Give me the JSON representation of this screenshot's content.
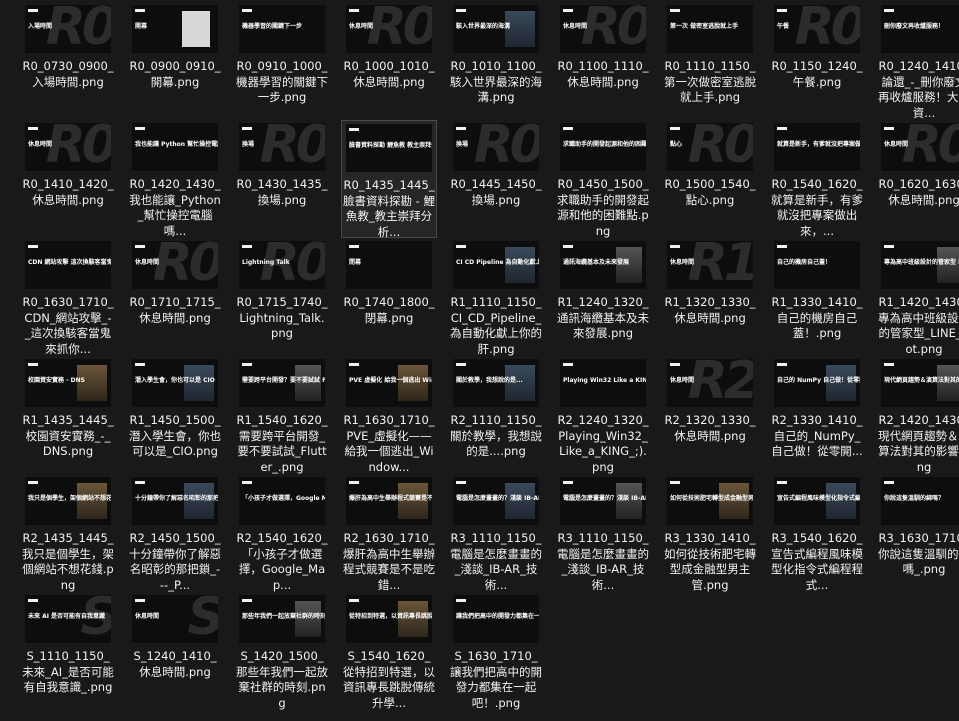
{
  "items": [
    {
      "id": "r0-0730",
      "label": "R0_0730_0900_入場時間.png",
      "thumb": "入場時間",
      "bg": "R0"
    },
    {
      "id": "r0-0900",
      "label": "R0_0900_0910_開幕.png",
      "thumb": "開幕",
      "bg": ""
    },
    {
      "id": "r0-0910",
      "label": "R0_0910_1000_機器學習的關鍵下一步.png",
      "thumb": "機器學習的關鍵下一步",
      "bg": ""
    },
    {
      "id": "r0-1000",
      "label": "R0_1000_1010_休息時間.png",
      "thumb": "休息時間",
      "bg": "R0"
    },
    {
      "id": "r0-1010",
      "label": "R0_1010_1100_駭入世界最深的海溝.png",
      "thumb": "駭入世界最深的海溝",
      "bg": ""
    },
    {
      "id": "r0-1100",
      "label": "R0_1100_1110_休息時間.png",
      "thumb": "休息時間",
      "bg": "R0"
    },
    {
      "id": "r0-1110",
      "label": "R0_1110_1150_第一次做密室逃脫就上手.png",
      "thumb": "第一次 做密室逃脫就上手",
      "bg": ""
    },
    {
      "id": "r0-1150",
      "label": "R0_1150_1240_午餐.png",
      "thumb": "午餐",
      "bg": "R0"
    },
    {
      "id": "r0-1240",
      "label": "R0_1240_1410_論還_-_刪你廢文再收爐服務！大型資...",
      "thumb": "刪你廢文再收爐服務！",
      "bg": ""
    },
    {
      "id": "r0-1410",
      "label": "R0_1410_1420_休息時間.png",
      "thumb": "休息時間",
      "bg": "R0"
    },
    {
      "id": "r0-1420",
      "label": "R0_1420_1430_我也能讓_Python_幫忙操控電腦嗎...",
      "thumb": "我也能讓 Python 幫忙操控電腦嗎",
      "bg": ""
    },
    {
      "id": "r0-1430",
      "label": "R0_1430_1435_換場.png",
      "thumb": "換場",
      "bg": "R0"
    },
    {
      "id": "r0-1435",
      "label": "R0_1435_1445_臉書資料探勘 - 鯉魚教_教主崇拜分析...",
      "thumb": "臉書資料探勘 鯉魚教 教主崇拜分析",
      "bg": ""
    },
    {
      "id": "r0-1445",
      "label": "R0_1445_1450_換場.png",
      "thumb": "換場",
      "bg": "R0"
    },
    {
      "id": "r0-1450",
      "label": "R0_1450_1500_求職助手的開發起源和他的困難點.png",
      "thumb": "求職助手的開發起源和他的困難點",
      "bg": ""
    },
    {
      "id": "r0-1500",
      "label": "R0_1500_1540_點心.png",
      "thumb": "點心",
      "bg": "R0"
    },
    {
      "id": "r0-1540",
      "label": "R0_1540_1620_就算是新手，有爹就沒把專案做出來，...",
      "thumb": "就算是新手，有爹就沒把專案做出來",
      "bg": ""
    },
    {
      "id": "r0-1620",
      "label": "R0_1620_1630_休息時間.png",
      "thumb": "休息時間",
      "bg": "R0"
    },
    {
      "id": "r0-1630",
      "label": "R0_1630_1710_CDN_網站攻擊_-_這次換駭客當鬼來抓你...",
      "thumb": "CDN 網站攻擊 這次換駭客當鬼來抓你",
      "bg": ""
    },
    {
      "id": "r0-1710",
      "label": "R0_1710_1715_休息時間.png",
      "thumb": "休息時間",
      "bg": "R0"
    },
    {
      "id": "r0-1715",
      "label": "R0_1715_1740_Lightning_Talk.png",
      "thumb": "Lightning Talk",
      "bg": "R0"
    },
    {
      "id": "r0-1740",
      "label": "R0_1740_1800_閉幕.png",
      "thumb": "閉幕",
      "bg": ""
    },
    {
      "id": "r1-1110",
      "label": "R1_1110_1150_CI_CD_Pipeline_為自動化獻上你的肝.png",
      "thumb": "CI CD Pipeline 為自動化獻上你的肝",
      "bg": ""
    },
    {
      "id": "r1-1240",
      "label": "R1_1240_1320_通訊海纜基本及未來發展.png",
      "thumb": "通訊海纜基本及未來發展",
      "bg": ""
    },
    {
      "id": "r1-1320",
      "label": "R1_1320_1330_休息時間.png",
      "thumb": "休息時間",
      "bg": "R1"
    },
    {
      "id": "r1-1330",
      "label": "R1_1330_1410_自己的機房自己蓋！.png",
      "thumb": "自己的機房自己蓋！",
      "bg": ""
    },
    {
      "id": "r1-1420",
      "label": "R1_1420_1430_專為高中班級設計的管家型_LINE_Bot.png",
      "thumb": "專為高中班級設計的管家型 LINE Bot",
      "bg": ""
    },
    {
      "id": "r1-1435",
      "label": "R1_1435_1445_校園資安實務_-_DNS.png",
      "thumb": "校園資安實務 - DNS",
      "bg": ""
    },
    {
      "id": "r1-1450",
      "label": "R1_1450_1500_潛入學生會，你也可以是_CIO.png",
      "thumb": "潛入學生會，你也可以是 CIO",
      "bg": ""
    },
    {
      "id": "r1-1540",
      "label": "R1_1540_1620_需要跨平台開發_要不要試試_Flutter_.png",
      "thumb": "需要跨平台開發？要不要試試 Flutter?",
      "bg": ""
    },
    {
      "id": "r1-1630",
      "label": "R1_1630_1710_PVE_虛擬化——給我一個逃出_Window...",
      "thumb": "PVE 虛擬化 給我一個逃出 Windows 的理由！",
      "bg": ""
    },
    {
      "id": "r2-1110",
      "label": "R2_1110_1150_關於教學，我想說的是....png",
      "thumb": "關於教學，我想說的是...",
      "bg": ""
    },
    {
      "id": "r2-1240",
      "label": "R2_1240_1320_Playing_Win32_Like_a_KING_;).png",
      "thumb": "Playing Win32 Like a KING ;)",
      "bg": ""
    },
    {
      "id": "r2-1320",
      "label": "R2_1320_1330_休息時間.png",
      "thumb": "休息時間",
      "bg": "R2"
    },
    {
      "id": "r2-1330",
      "label": "R2_1330_1410_自己的_NumPy_自己做！從零開...",
      "thumb": "自己的 NumPy 自己做！從零開始打造多維陣列",
      "bg": ""
    },
    {
      "id": "r2-1420",
      "label": "R2_1420_1430_現代網頁趨勢＆演算法對其的影響.png",
      "thumb": "現代網頁趨勢＆演算法對其的影響",
      "bg": ""
    },
    {
      "id": "r2-1435",
      "label": "R2_1435_1445_我只是個學生，架個網站不想花錢.png",
      "thumb": "我只是個學生，架個網站不想花錢",
      "bg": ""
    },
    {
      "id": "r2-1450",
      "label": "R2_1450_1500_十分鐘帶你了解惡名昭彰的那把鎖_---_P...",
      "thumb": "十分鐘帶你了解惡名昭彰的那把鎖 Python GIL",
      "bg": ""
    },
    {
      "id": "r2-1540",
      "label": "R2_1540_1620_「小孩子才做選擇，Google_Map...",
      "thumb": "「小孩子才做選擇，Google Maps 與 OSM 我全都要」",
      "bg": ""
    },
    {
      "id": "r2-1630",
      "label": "R2_1630_1710_爆肝為高中生舉辦程式競賽是不是吃錯...",
      "thumb": "爆肝為高中生舉辦程式競賽是不是吃錯藥？",
      "bg": ""
    },
    {
      "id": "r3-1110",
      "label": "R3_1110_1150_電腦是怎麼畫畫的_淺談_IB-AR_技術...",
      "thumb": "電腦是怎麼畫畫的？淺談 IB-AR 技術",
      "bg": ""
    },
    {
      "id": "r3-1150",
      "label": "R3_1110_1150_電腦是怎麼畫畫的_淺談_IB-AR_技術...",
      "thumb": "電腦是怎麼畫畫的？淺談 IB-AR 技術",
      "bg": ""
    },
    {
      "id": "r3-1330",
      "label": "R3_1330_1410_如何從技術肥宅轉型成金融型男主管.png",
      "thumb": "如何從技術肥宅轉型成金融型男主管",
      "bg": ""
    },
    {
      "id": "r3-1540",
      "label": "R3_1540_1620_宣告式編程風味模型化指令式編程程式...",
      "thumb": "宣告式編程風味模型化指令式編程程式碼",
      "bg": ""
    },
    {
      "id": "r3-1630",
      "label": "R3_1630_1710_你說這隻溫馴的綿嗎_.png",
      "thumb": "你說這隻溫馴的綿嗎？",
      "bg": ""
    },
    {
      "id": "s-1110",
      "label": "S_1110_1150_未來_AI_是否可能有自我意識_.png",
      "thumb": "未來 AI 是否可能有自我意識",
      "bg": "S"
    },
    {
      "id": "s-1240",
      "label": "S_1240_1410_休息時間.png",
      "thumb": "休息時間",
      "bg": "S"
    },
    {
      "id": "s-1420",
      "label": "S_1420_1500_那些年我們一起放棄社群的時刻.png",
      "thumb": "那些年我們一起放棄社群的時刻",
      "bg": ""
    },
    {
      "id": "s-1540",
      "label": "S_1540_1620_從特招到特選，以資訊專長跳脫傳統升學...",
      "thumb": "從特招到特選，以資訊專長跳脫傳統升學體制",
      "bg": ""
    },
    {
      "id": "s-1630",
      "label": "S_1630_1710_讓我們把高中的開發力都集在一起吧！.png",
      "thumb": "讓我們把高中的開發力都集在一起吧！",
      "bg": ""
    }
  ]
}
